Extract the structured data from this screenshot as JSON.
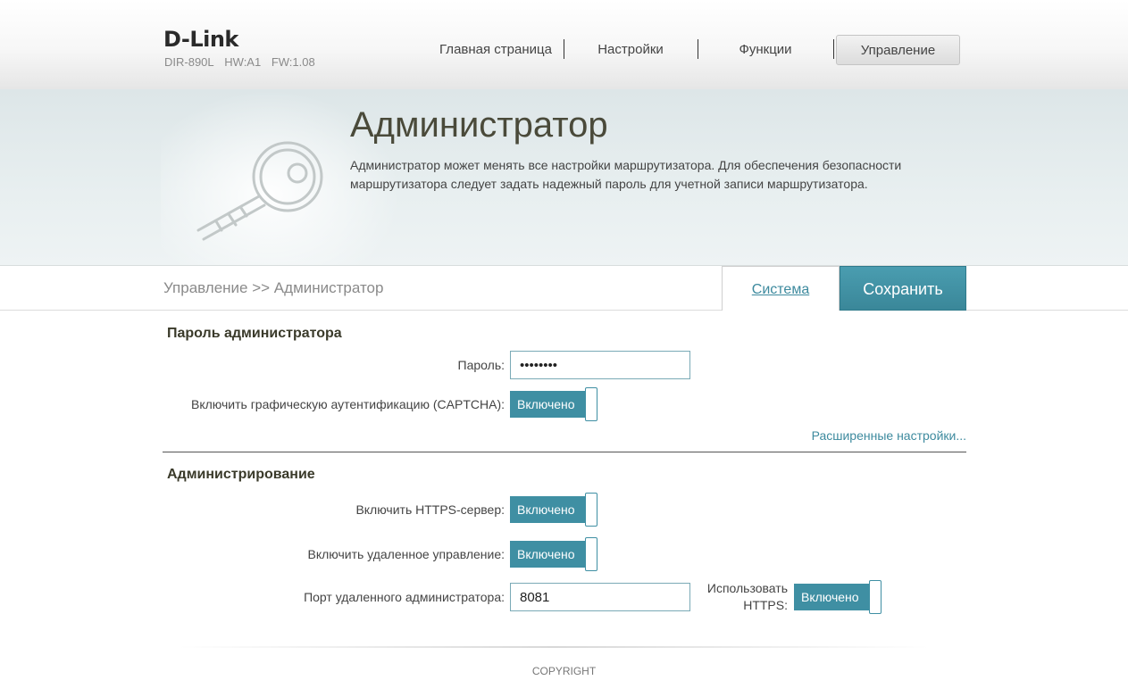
{
  "header": {
    "logo": "D-Link",
    "model": "DIR-890L",
    "hw": "HW:A1",
    "fw": "FW:1.08",
    "nav": [
      "Главная страница",
      "Настройки",
      "Функции",
      "Управление"
    ],
    "active_nav": "Управление"
  },
  "banner": {
    "title": "Администратор",
    "description": "Администратор может менять все настройки маршрутизатора. Для обеспечения безопасности маршрутизатора следует задать надежный пароль для учетной записи маршрутизатора."
  },
  "breadcrumb": "Управление >> Администратор",
  "actions": {
    "system": "Система",
    "save": "Сохранить"
  },
  "admin_password": {
    "title": "Пароль администратора",
    "password_label": "Пароль:",
    "password_value": "••••••••",
    "captcha_label": "Включить графическую аутентификацию (CAPTCHA):",
    "captcha_state": "Включено",
    "advanced_link": "Расширенные настройки..."
  },
  "administration": {
    "title": "Администрирование",
    "https_server_label": "Включить HTTPS-сервер:",
    "https_server_state": "Включено",
    "remote_mgmt_label": "Включить удаленное управление:",
    "remote_mgmt_state": "Включено",
    "remote_port_label": "Порт удаленного администратора:",
    "remote_port_value": "8081",
    "use_https_line1": "Использовать",
    "use_https_line2": "HTTPS:",
    "use_https_state": "Включено"
  },
  "footer": {
    "copyright": "COPYRIGHT"
  },
  "colors": {
    "accent": "#3f8fa3",
    "link": "#3d8a9e"
  }
}
